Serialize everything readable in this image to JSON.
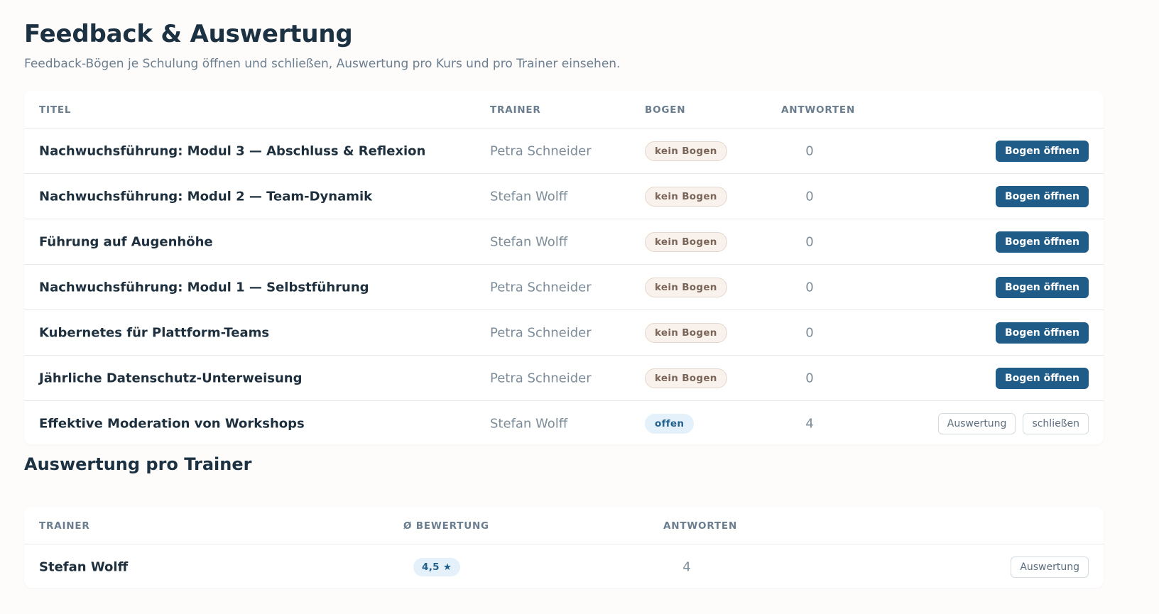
{
  "header": {
    "title": "Feedback & Auswertung",
    "subtitle": "Feedback-Bögen je Schulung öffnen und schließen, Auswertung pro Kurs und pro Trainer einsehen."
  },
  "courses": {
    "columns": {
      "title": "TITEL",
      "trainer": "TRAINER",
      "bogen": "BOGEN",
      "answers": "ANTWORTEN"
    },
    "rows": [
      {
        "title": "Nachwuchsführung: Modul 3 — Abschluss & Reflexion",
        "trainer": "Petra Schneider",
        "bogen": "kein Bogen",
        "answers": "0",
        "action": "Bogen öffnen"
      },
      {
        "title": "Nachwuchsführung: Modul 2 — Team-Dynamik",
        "trainer": "Stefan Wolff",
        "bogen": "kein Bogen",
        "answers": "0",
        "action": "Bogen öffnen"
      },
      {
        "title": "Führung auf Augenhöhe",
        "trainer": "Stefan Wolff",
        "bogen": "kein Bogen",
        "answers": "0",
        "action": "Bogen öffnen"
      },
      {
        "title": "Nachwuchsführung: Modul 1 — Selbstführung",
        "trainer": "Petra Schneider",
        "bogen": "kein Bogen",
        "answers": "0",
        "action": "Bogen öffnen"
      },
      {
        "title": "Kubernetes für Plattform-Teams",
        "trainer": "Petra Schneider",
        "bogen": "kein Bogen",
        "answers": "0",
        "action": "Bogen öffnen"
      },
      {
        "title": "Jährliche Datenschutz-Unterweisung",
        "trainer": "Petra Schneider",
        "bogen": "kein Bogen",
        "answers": "0",
        "action": "Bogen öffnen"
      },
      {
        "title": "Effektive Moderation von Workshops",
        "trainer": "Stefan Wolff",
        "bogen": "offen",
        "answers": "4",
        "action_evaluate": "Auswertung",
        "action_close": "schließen"
      }
    ]
  },
  "trainers": {
    "title": "Auswertung pro Trainer",
    "columns": {
      "trainer": "TRAINER",
      "rating": "Ø BEWERTUNG",
      "answers": "ANTWORTEN"
    },
    "rows": [
      {
        "name": "Stefan Wolff",
        "rating": "4,5 ★",
        "answers": "4",
        "action": "Auswertung"
      }
    ]
  },
  "colors": {
    "primary": "#1f5c88",
    "heading": "#1c3142",
    "muted": "#7c8c99",
    "badge_none_bg": "#f8f1ec",
    "badge_open_bg": "#e5f1fa"
  }
}
